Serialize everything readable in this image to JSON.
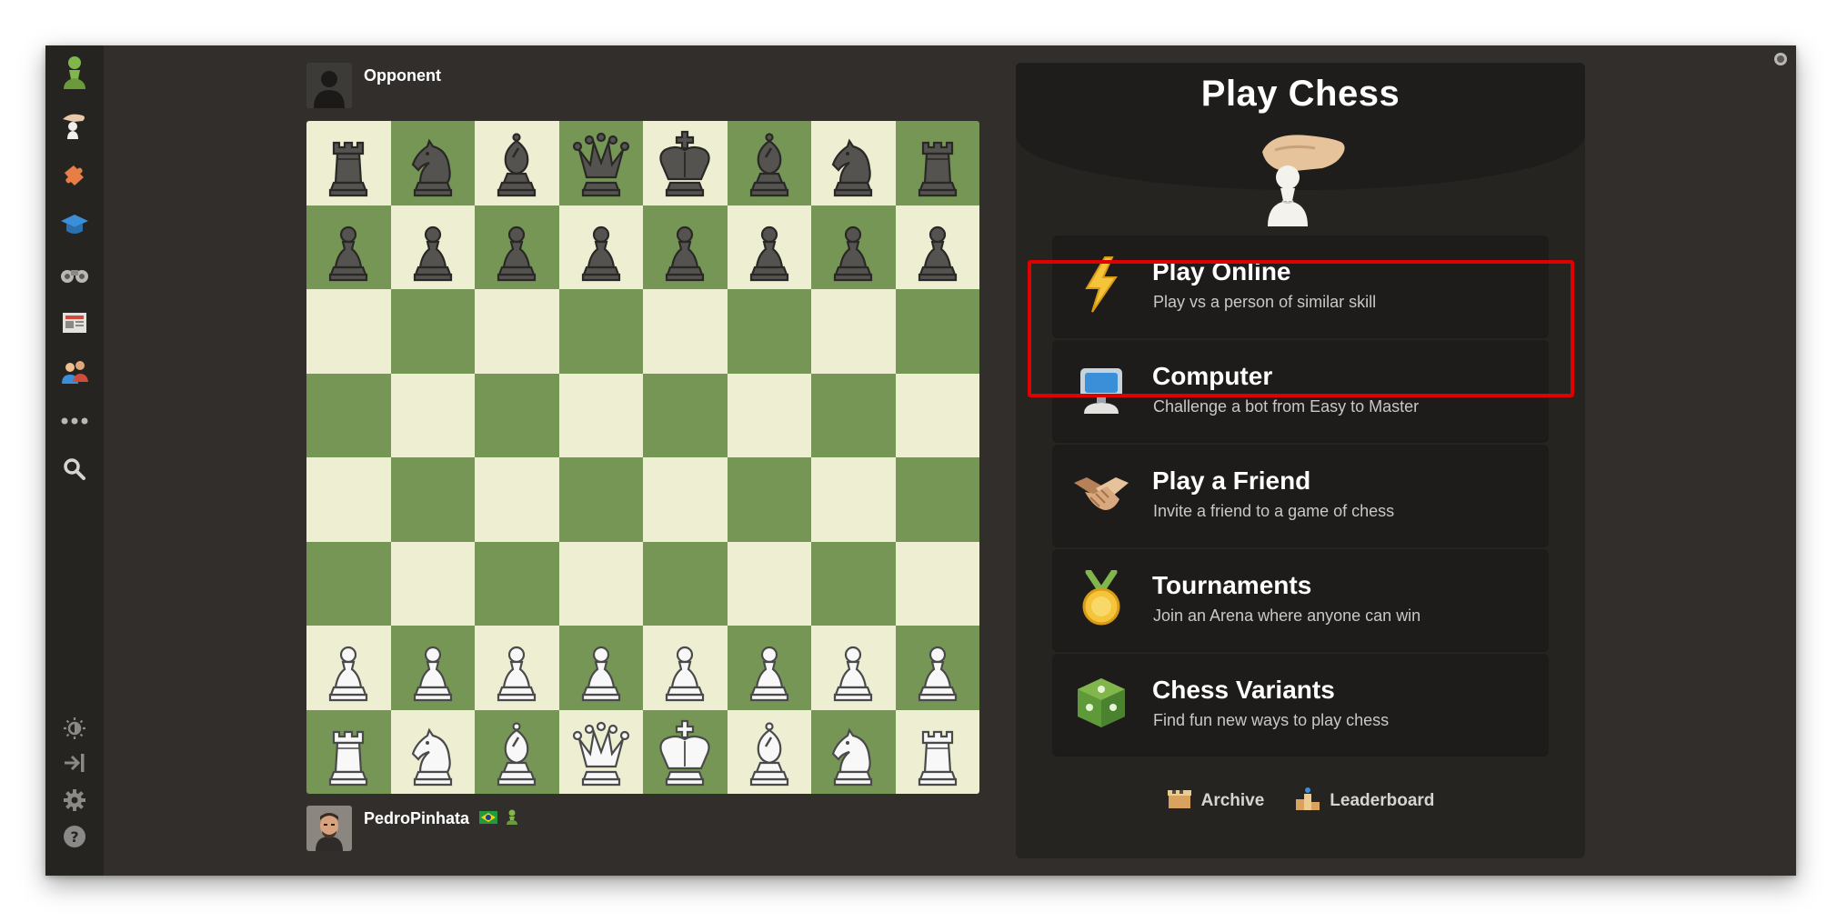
{
  "opponent": {
    "name": "Opponent"
  },
  "player": {
    "name": "PedroPinhata",
    "flag": "brazil-flag-icon",
    "badge": "pawn-badge-icon"
  },
  "sidebar": {
    "items": [
      {
        "icon": "chess-com-pawn-logo-icon"
      },
      {
        "icon": "play-hand-pawn-icon"
      },
      {
        "icon": "puzzle-piece-icon"
      },
      {
        "icon": "learn-graduation-cap-icon"
      },
      {
        "icon": "watch-binoculars-icon"
      },
      {
        "icon": "news-newspaper-icon"
      },
      {
        "icon": "social-people-icon"
      },
      {
        "icon": "more-dots-icon"
      },
      {
        "icon": "search-icon"
      }
    ],
    "bottom_items": [
      {
        "icon": "theme-brightness-icon"
      },
      {
        "icon": "collapse-sidebar-icon"
      },
      {
        "icon": "settings-gear-icon"
      },
      {
        "icon": "help-question-icon"
      }
    ]
  },
  "board": {
    "rows": [
      [
        "br",
        "bn",
        "bb",
        "bq",
        "bk",
        "bb",
        "bn",
        "br"
      ],
      [
        "bp",
        "bp",
        "bp",
        "bp",
        "bp",
        "bp",
        "bp",
        "bp"
      ],
      [
        "",
        "",
        "",
        "",
        "",
        "",
        "",
        ""
      ],
      [
        "",
        "",
        "",
        "",
        "",
        "",
        "",
        ""
      ],
      [
        "",
        "",
        "",
        "",
        "",
        "",
        "",
        ""
      ],
      [
        "",
        "",
        "",
        "",
        "",
        "",
        "",
        ""
      ],
      [
        "wp",
        "wp",
        "wp",
        "wp",
        "wp",
        "wp",
        "wp",
        "wp"
      ],
      [
        "wr",
        "wn",
        "wb",
        "wq",
        "wk",
        "wb",
        "wn",
        "wr"
      ]
    ]
  },
  "panel": {
    "title": "Play Chess",
    "options": [
      {
        "title": "Play Online",
        "subtitle": "Play vs a person of similar skill",
        "icon": "lightning-bolt-icon"
      },
      {
        "title": "Computer",
        "subtitle": "Challenge a bot from Easy to Master",
        "icon": "computer-robot-icon"
      },
      {
        "title": "Play a Friend",
        "subtitle": "Invite a friend to a game of chess",
        "icon": "handshake-icon"
      },
      {
        "title": "Tournaments",
        "subtitle": "Join an Arena where anyone can win",
        "icon": "medal-icon"
      },
      {
        "title": "Chess Variants",
        "subtitle": "Find fun new ways to play chess",
        "icon": "variants-dice-icon"
      }
    ],
    "links": [
      {
        "label": "Archive",
        "icon": "archive-box-icon"
      },
      {
        "label": "Leaderboard",
        "icon": "leaderboard-podium-icon"
      }
    ]
  },
  "colors": {
    "background": "#312e2b",
    "sidebar": "#262421",
    "board_light": "#eeeed2",
    "board_dark": "#769656",
    "highlight": "#e00000"
  }
}
